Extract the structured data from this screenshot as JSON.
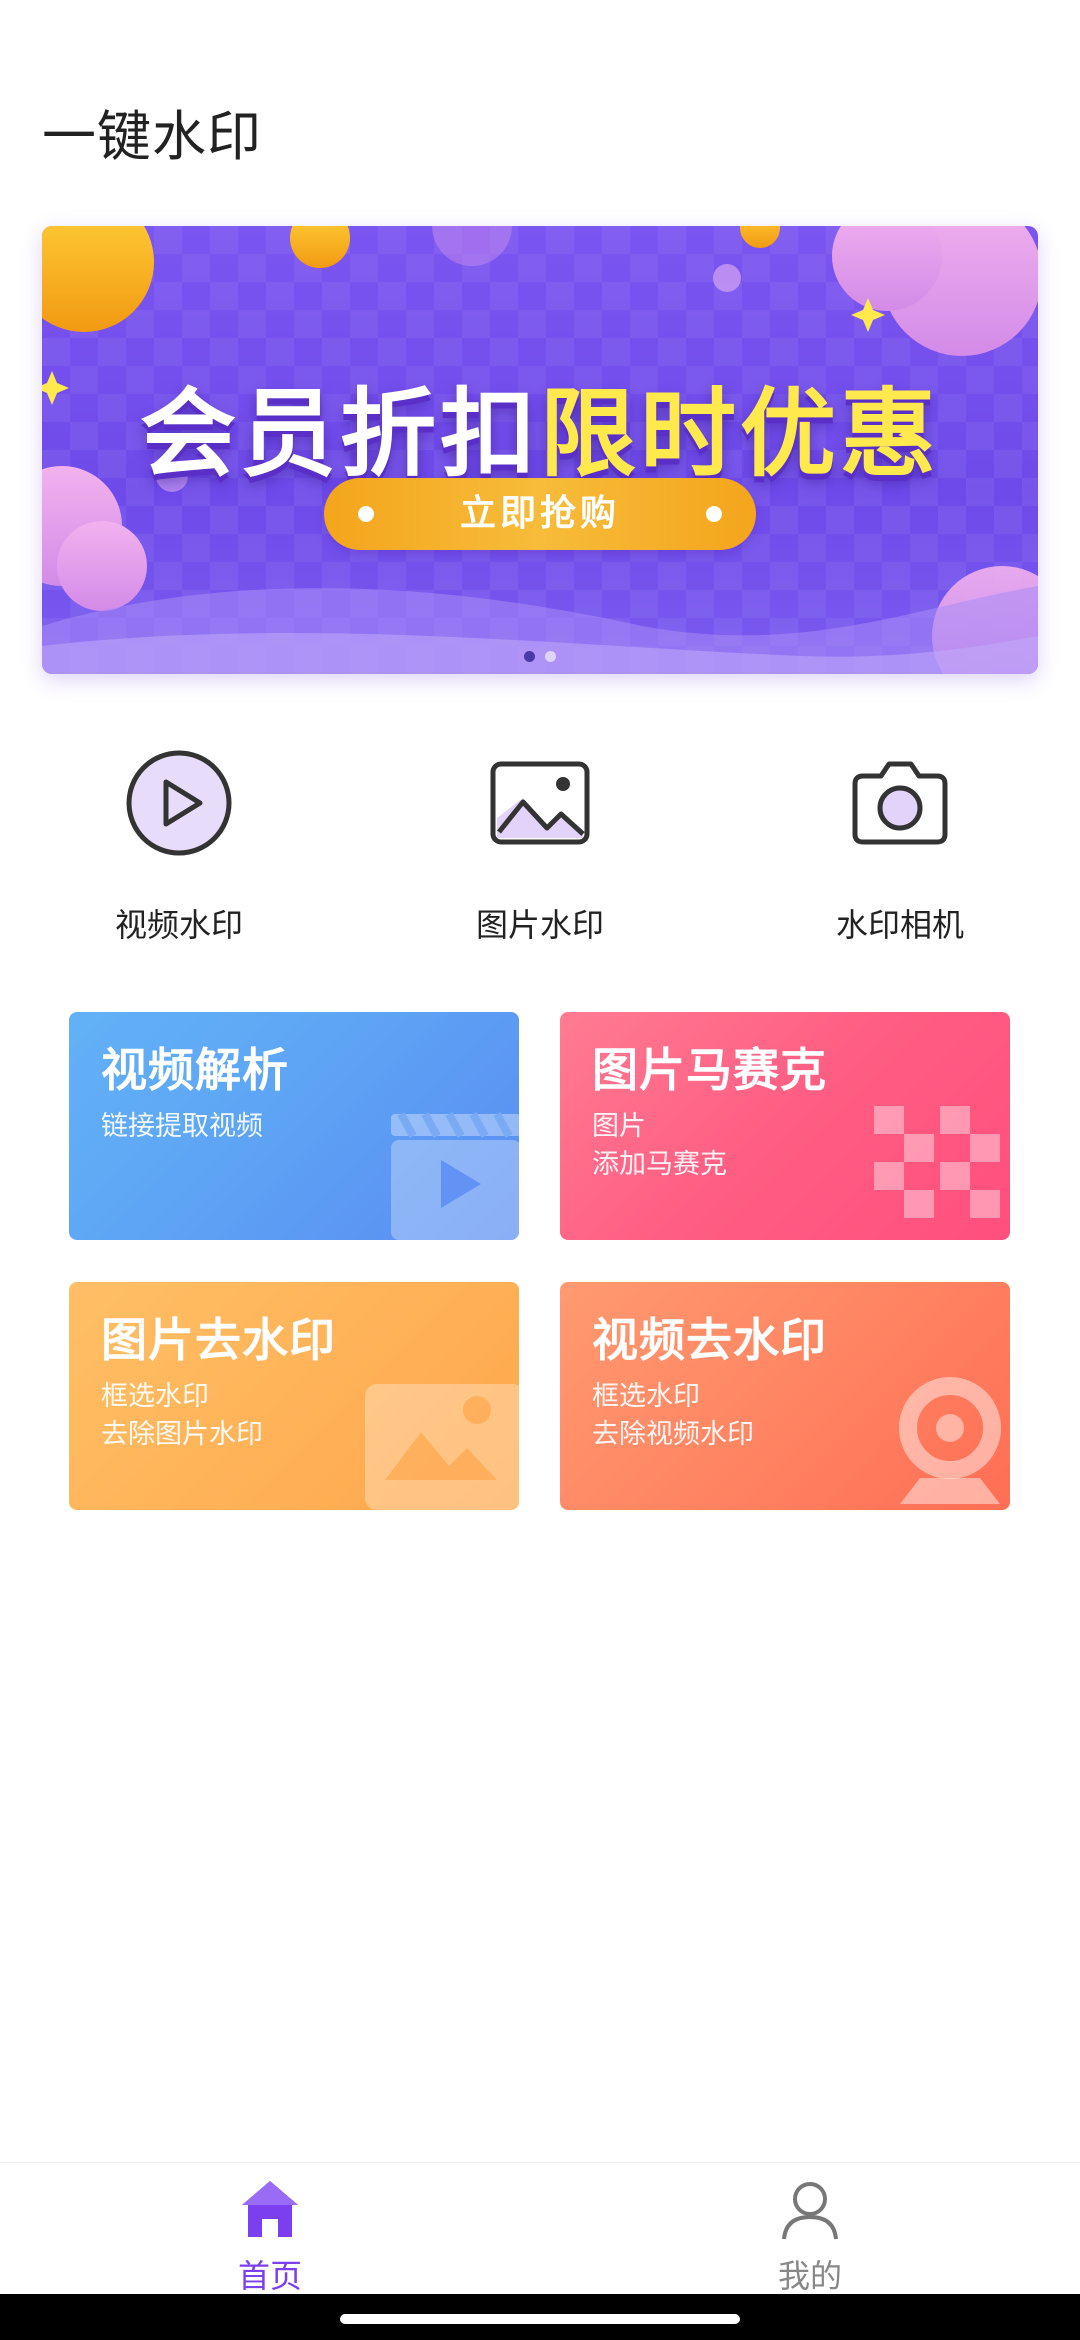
{
  "app": {
    "title": "一键水印"
  },
  "banner": {
    "headline_part1": "会员折扣",
    "headline_part2": "限时优惠",
    "cta": "立即抢购",
    "pages": 2,
    "active_page": 1,
    "colors": {
      "background": "#7052ee",
      "highlight": "#ffe94d",
      "cta": "#f6ad2b"
    }
  },
  "tools": [
    {
      "label": "视频水印",
      "icon": "play-circle-icon"
    },
    {
      "label": "图片水印",
      "icon": "image-icon"
    },
    {
      "label": "水印相机",
      "icon": "camera-icon"
    }
  ],
  "cards": [
    {
      "title": "视频解析",
      "lines": [
        "链接提取视频"
      ],
      "icon": "video-clapper-icon",
      "color": "#5ea6f5"
    },
    {
      "title": "图片马赛克",
      "lines": [
        "图片",
        "添加马赛克"
      ],
      "icon": "mosaic-icon",
      "color": "#ff5d83"
    },
    {
      "title": "图片去水印",
      "lines": [
        "框选水印",
        "去除图片水印"
      ],
      "icon": "landscape-image-icon",
      "color": "#ffb358"
    },
    {
      "title": "视频去水印",
      "lines": [
        "框选水印",
        "去除视频水印"
      ],
      "icon": "webcam-icon",
      "color": "#ff8563"
    }
  ],
  "nav": {
    "home_label": "首页",
    "profile_label": "我的",
    "active": "home",
    "active_color": "#7b3ff0"
  }
}
